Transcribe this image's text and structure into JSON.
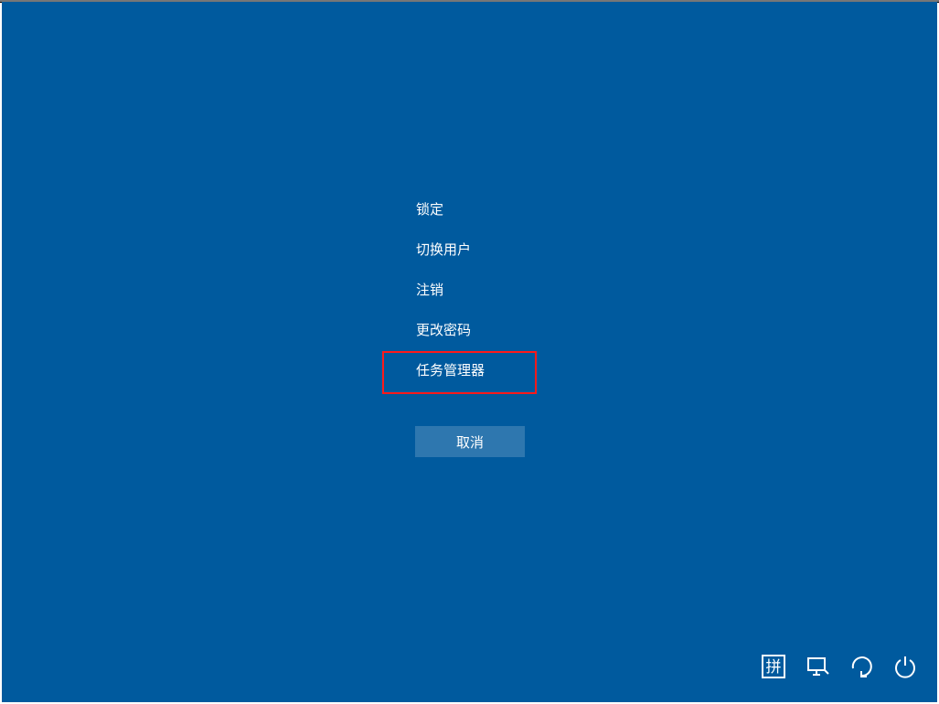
{
  "menu": {
    "lock": "锁定",
    "switch_user": "切换用户",
    "sign_out": "注销",
    "change_password": "更改密码",
    "task_manager": "任务管理器",
    "highlighted": "task_manager"
  },
  "cancel_label": "取消",
  "tray": {
    "ime": "拼",
    "network": "network",
    "ease_of_access": "ease-of-access",
    "power": "power"
  },
  "colors": {
    "background": "#005a9e",
    "highlight": "#ff1a1a",
    "button_bg": "rgba(255,255,255,0.18)"
  }
}
